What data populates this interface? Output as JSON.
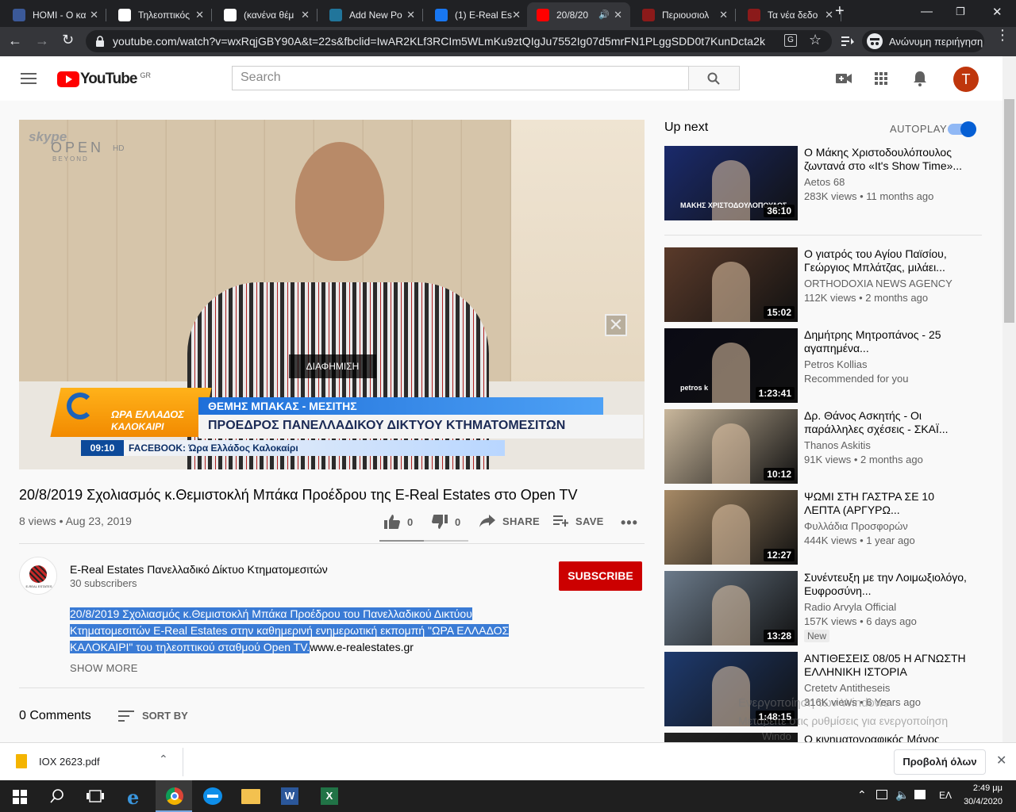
{
  "browser": {
    "tabs": [
      {
        "title": "HOMI - Ο κα",
        "color": "#3b5998",
        "active": false
      },
      {
        "title": "Τηλεοπτικός",
        "color": "#ffffff",
        "active": false
      },
      {
        "title": "(κανένα θέμ",
        "color": "#ffffff",
        "active": false
      },
      {
        "title": "Add New Po",
        "color": "#21759b",
        "active": false
      },
      {
        "title": "(1) E-Real Es",
        "color": "#1877f2",
        "active": false
      },
      {
        "title": "20/8/20",
        "color": "#ff0000",
        "active": true
      },
      {
        "title": "Περιουσιολ",
        "color": "#8b1a1a",
        "active": false
      },
      {
        "title": "Τα νέα δεδο",
        "color": "#8b1a1a",
        "active": false
      }
    ],
    "url": "youtube.com/watch?v=wxRqjGBY90A&t=22s&fbclid=IwAR2KLf3RCIm5WLmKu9ztQIgJu7552Ig07d5mrFN1PLggSDD0t7KunDcta2k",
    "incognito_label": "Ανώνυμη περιήγηση"
  },
  "youtube": {
    "logo_text": "YouTube",
    "region": "GR",
    "search_placeholder": "Search",
    "avatar_letter": "T"
  },
  "video": {
    "overlay_logo": "skype",
    "overlay_channel": "OPEN",
    "overlay_hd": "HD",
    "overlay_beyond": "BEYOND",
    "ad_label": "ΔΙΑΦΗΜΙΣΗ",
    "show_name_1": "ΩΡΑ ΕΛΛΑΔΟΣ",
    "show_name_2": "ΚΑΛΟΚΑΙΡΙ",
    "lower_third_name": "ΘΕΜΗΣ ΜΠΑΚΑΣ - ΜΕΣΙΤΗΣ",
    "lower_third_role": "ΠΡΟΕΔΡΟΣ ΠΑΝΕΛΛΑΔΙΚΟΥ ΔΙΚΤΥΟΥ ΚΤΗΜΑΤΟΜΕΣΙΤΩΝ",
    "clock": "09:10",
    "ticker": "FACEBOOK: Ώρα Ελλάδος Καλοκαίρι",
    "title": "20/8/2019 Σχολιασμός κ.Θεμιστοκλή Μπάκα Προέδρου της E-Real Estates στο Open TV",
    "views_date": "8 views • Aug 23, 2019",
    "likes": "0",
    "dislikes": "0",
    "share_label": "SHARE",
    "save_label": "SAVE"
  },
  "channel": {
    "name": "E-Real Estates Πανελλαδικό Δίκτυο Κτηματομεσιτών",
    "subscribers": "30 subscribers",
    "subscribe_label": "SUBSCRIBE",
    "avatar_text": "E-REAL ESTATES"
  },
  "description": {
    "line1": "20/8/2019 Σχολιασμός κ.Θεμιστοκλή Μπάκα Προέδρου του Πανελλαδικού Δικτύου",
    "line2": "Κτηματομεσιτών E-Real Estates στην καθημερινή ενημερωτική εκπομπή \"ΩΡΑ ΕΛΛΑΔΟΣ",
    "line3": "ΚΑΛΟΚΑΙΡΙ\" του τηλεοπτικού σταθμού Open TV.",
    "link": "www.e-realestates.gr",
    "show_more": "SHOW MORE"
  },
  "comments": {
    "count": "0 Comments",
    "sort_label": "SORT BY"
  },
  "sidebar": {
    "up_next": "Up next",
    "autoplay": "AUTOPLAY",
    "cards": [
      {
        "title": "Ο Μάκης Χριστοδουλόπουλος ζωντανά στο «It's Show Time»...",
        "channel": "Aetos 68",
        "meta": "283K views • 11 months ago",
        "duration": "36:10",
        "bg": "#1a2a6c",
        "caption": "ΜΑΚΗΣ ΧΡΙΣΤΟΔΟΥΛΟΠΟΥΛΟΣ"
      },
      {
        "title": "Ο γιατρός του Αγίου Παϊσίου, Γεώργιος Μπλάτζας, μιλάει...",
        "channel": "ORTHODOXIA NEWS AGENCY",
        "meta": "112K views • 2 months ago",
        "duration": "15:02",
        "bg": "#5a3a2a"
      },
      {
        "title": "Δημήτρης Μητροπάνος - 25 αγαπημένα...",
        "channel": "Petros Kollias",
        "meta": "Recommended for you",
        "duration": "1:23:41",
        "bg": "#0a0a14",
        "caption": "petros k"
      },
      {
        "title": "Δρ. Θάνος Ασκητής - Οι παράλληλες σχέσεις - ΣΚΑΪ...",
        "channel": "Thanos Askitis",
        "meta": "91K views • 2 months ago",
        "duration": "10:12",
        "bg": "#c9b79c"
      },
      {
        "title": "ΨΩΜΙ ΣΤΗ ΓΑΣΤΡΑ ΣΕ 10 ΛΕΠΤΑ (ΑΡΓΥΡΩ...",
        "channel": "Φυλλάδια Προσφορών",
        "meta": "444K views • 1 year ago",
        "duration": "12:27",
        "bg": "#a78a66"
      },
      {
        "title": "Συνέντευξη με την Λοιμωξιολόγο, Ευφροσύνη...",
        "channel": "Radio Arvyla Official",
        "meta": "157K views • 6 days ago",
        "duration": "13:28",
        "bg": "#6b7a8a",
        "badge": "New"
      },
      {
        "title": "ΑΝΤΙΘΕΣΕΙΣ 08/05 Η ΑΓΝΩΣΤΗ ΕΛΛΗΝΙΚΗ ΙΣΤΟΡΙΑ",
        "channel": "Cretetv Antitheseis",
        "meta": "316K views • 6 Years ago",
        "duration": "1:48:15",
        "bg": "#1e3a6e"
      },
      {
        "title": "Ο κινηματογραφικός Μάνος",
        "channel": "",
        "meta": "",
        "duration": "",
        "bg": "#222222"
      }
    ]
  },
  "watermark": {
    "line1": "Ενεργοποίηση των Windows",
    "line2": "Μεταβείτε στις ρυθμίσεις για ενεργοποίηση",
    "line3": "Windo"
  },
  "downloads": {
    "file": "IOX 2623.pdf",
    "show_all": "Προβολή όλων"
  },
  "taskbar": {
    "lang": "ΕΛ",
    "time": "2:49 μμ",
    "date": "30/4/2020"
  }
}
